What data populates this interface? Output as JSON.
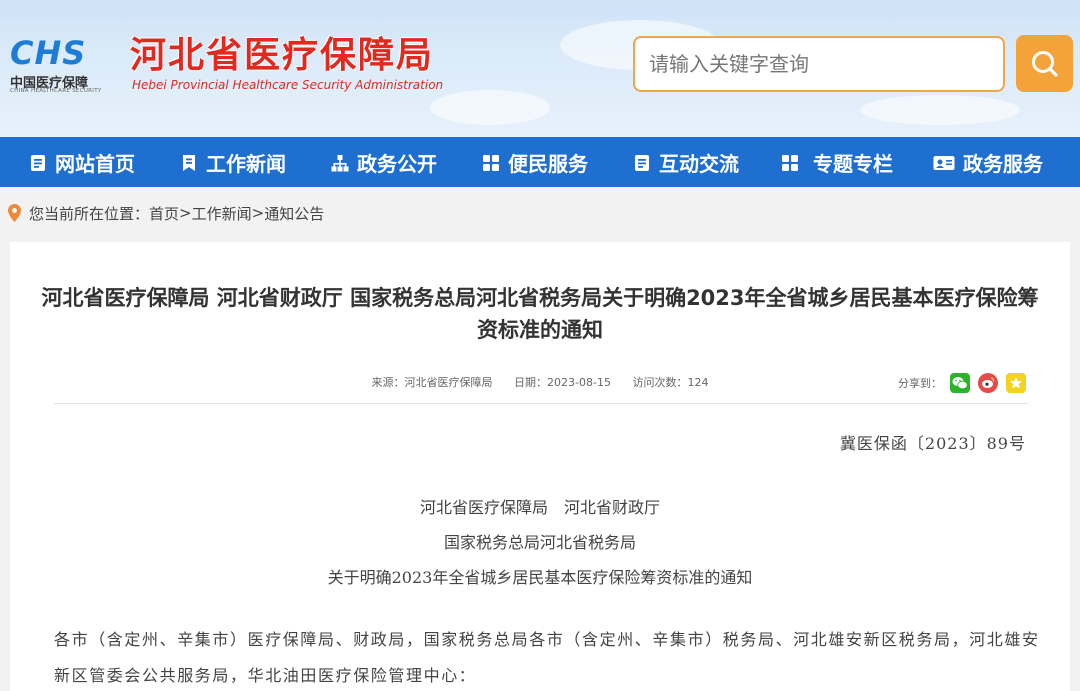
{
  "header": {
    "logo_text": "CHS",
    "logo_cn": "中国医疗保障",
    "logo_en": "CHINA HEALTHCARE SECURITY",
    "site_title": "河北省医疗保障局",
    "site_subtitle": "Hebei Provincial Healthcare Security Administration",
    "search_placeholder": "请输入关键字查询",
    "search_icon": "search-icon"
  },
  "nav": {
    "items": [
      {
        "label": "网站首页",
        "icon": "document-icon"
      },
      {
        "label": "工作新闻",
        "icon": "bookmark-icon"
      },
      {
        "label": "政务公开",
        "icon": "org-chart-icon"
      },
      {
        "label": "便民服务",
        "icon": "grid-icon"
      },
      {
        "label": "互动交流",
        "icon": "document-icon"
      },
      {
        "label": "专题专栏",
        "icon": "grid-icon"
      },
      {
        "label": "政务服务",
        "icon": "id-card-icon"
      }
    ]
  },
  "breadcrumb": {
    "prefix": "您当前所在位置：",
    "path": [
      "首页",
      "工作新闻",
      "通知公告"
    ],
    "separator": ">"
  },
  "article": {
    "title": "河北省医疗保障局 河北省财政厅 国家税务总局河北省税务局关于明确2023年全省城乡居民基本医疗保险筹资标准的通知",
    "source_label": "来源：",
    "source": "河北省医疗保障局",
    "date_label": "日期：",
    "date": "2023-08-15",
    "views_label": "访问次数：",
    "views": "124",
    "share_label": "分享到：",
    "share_icons": [
      "wechat-icon",
      "weibo-icon",
      "qzone-icon"
    ],
    "doc_number": "冀医保函〔2023〕89号",
    "header_lines": [
      "河北省医疗保障局　河北省财政厅",
      "国家税务总局河北省税务局",
      "关于明确2023年全省城乡居民基本医疗保险筹资标准的通知"
    ],
    "salutation": "各市（含定州、辛集市）医疗保障局、财政局，国家税务总局各市（含定州、辛集市）税务局、河北雄安新区税务局，河北雄安新区管委会公共服务局，华北油田医疗保险管理中心："
  },
  "colors": {
    "nav_bg": "#1e6fcf",
    "title_red": "#e02a20",
    "search_orange": "#f4a33a",
    "logo_blue": "#1d7cd6"
  }
}
